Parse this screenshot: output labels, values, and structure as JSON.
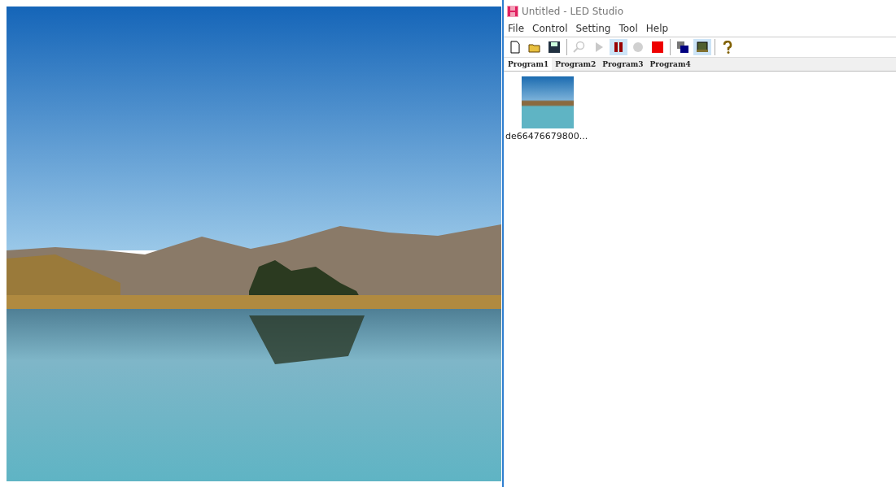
{
  "window": {
    "title": "Untitled - LED Studio"
  },
  "menu": [
    "File",
    "Control",
    "Setting",
    "Tool",
    "Help"
  ],
  "toolbar": [
    {
      "kind": "new",
      "disabled": false,
      "pressed": false
    },
    {
      "kind": "open",
      "disabled": false,
      "pressed": false
    },
    {
      "kind": "save",
      "disabled": false,
      "pressed": false
    },
    {
      "kind": "sep"
    },
    {
      "kind": "zoom",
      "disabled": true,
      "pressed": false
    },
    {
      "kind": "play",
      "disabled": true,
      "pressed": false
    },
    {
      "kind": "pause",
      "disabled": false,
      "pressed": true
    },
    {
      "kind": "record",
      "disabled": true,
      "pressed": false
    },
    {
      "kind": "stop",
      "disabled": false,
      "pressed": false
    },
    {
      "kind": "sep"
    },
    {
      "kind": "layers",
      "disabled": false,
      "pressed": false
    },
    {
      "kind": "screen",
      "disabled": false,
      "pressed": true
    },
    {
      "kind": "sep"
    },
    {
      "kind": "help",
      "disabled": false,
      "pressed": false
    }
  ],
  "tabs": [
    {
      "label": "Program1",
      "selected": true
    },
    {
      "label": "Program2",
      "selected": false
    },
    {
      "label": "Program3",
      "selected": false
    },
    {
      "label": "Program4",
      "selected": false
    }
  ],
  "files": [
    {
      "name": "de66476679800..."
    }
  ]
}
